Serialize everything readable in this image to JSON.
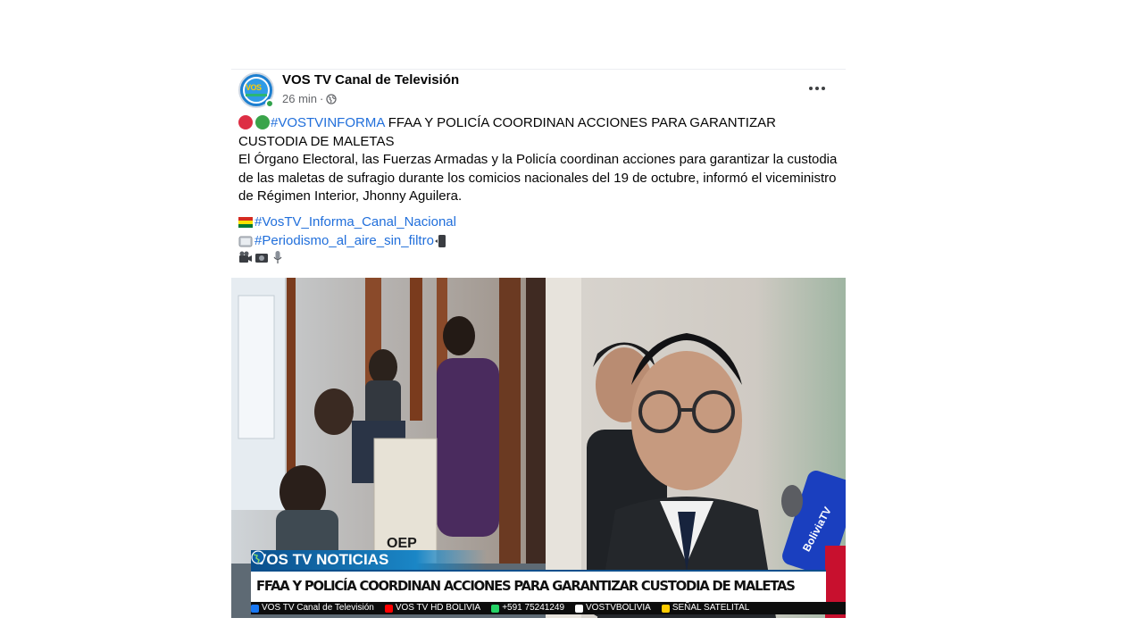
{
  "post": {
    "page_name": "VOS TV Canal de Televisión",
    "time": "26 min",
    "separator": "·",
    "avatar_text": "VOS",
    "privacy_icon": "globe-icon",
    "more_icon": "more-options-icon",
    "hashtag_main": "#VOSTVINFORMA",
    "headline_text": " FFAA Y POLICÍA COORDINAN ACCIONES PARA GARANTIZAR CUSTODIA DE MALETAS",
    "body": "El Órgano Electoral, las Fuerzas Armadas y la Policía coordinan acciones para garantizar la custodia de las maletas de sufragio durante los comicios nacionales del 19 de octubre, informó el viceministro de Régimen Interior, Jhonny Aguilera.",
    "tag_1": "#VosTV_Informa_Canal_Nacional",
    "tag_2": "#Periodismo_al_aire_sin_filtro",
    "emoji_line": [
      "video-camera-icon",
      "camera-icon",
      "microphone-icon"
    ]
  },
  "media": {
    "box_text": "OEP",
    "mic_text": "BoliviaTV",
    "banner_title": "VOS TV NOTICIAS",
    "headline": "FFAA Y POLICÍA COORDINAN ACCIONES PARA GARANTIZAR CUSTODIA DE MALETAS",
    "ticker": [
      {
        "icon": "facebook-icon",
        "color": "#1877f2",
        "text": "VOS TV Canal de Televisión"
      },
      {
        "icon": "youtube-icon",
        "color": "#ff0000",
        "text": "VOS TV HD BOLIVIA"
      },
      {
        "icon": "whatsapp-icon",
        "color": "#25d366",
        "text": "+591 75241249"
      },
      {
        "icon": "tiktok-icon",
        "color": "#ffffff",
        "text": "VOSTVBOLIVIA"
      },
      {
        "icon": "satellite-icon",
        "color": "#ffcc00",
        "text": "SEÑAL SATELITAL"
      }
    ]
  },
  "colors": {
    "hashtag": "#216fdb",
    "meta": "#65676b",
    "banner": "#1a86c6",
    "ticker_bg": "#0d0d0d"
  }
}
